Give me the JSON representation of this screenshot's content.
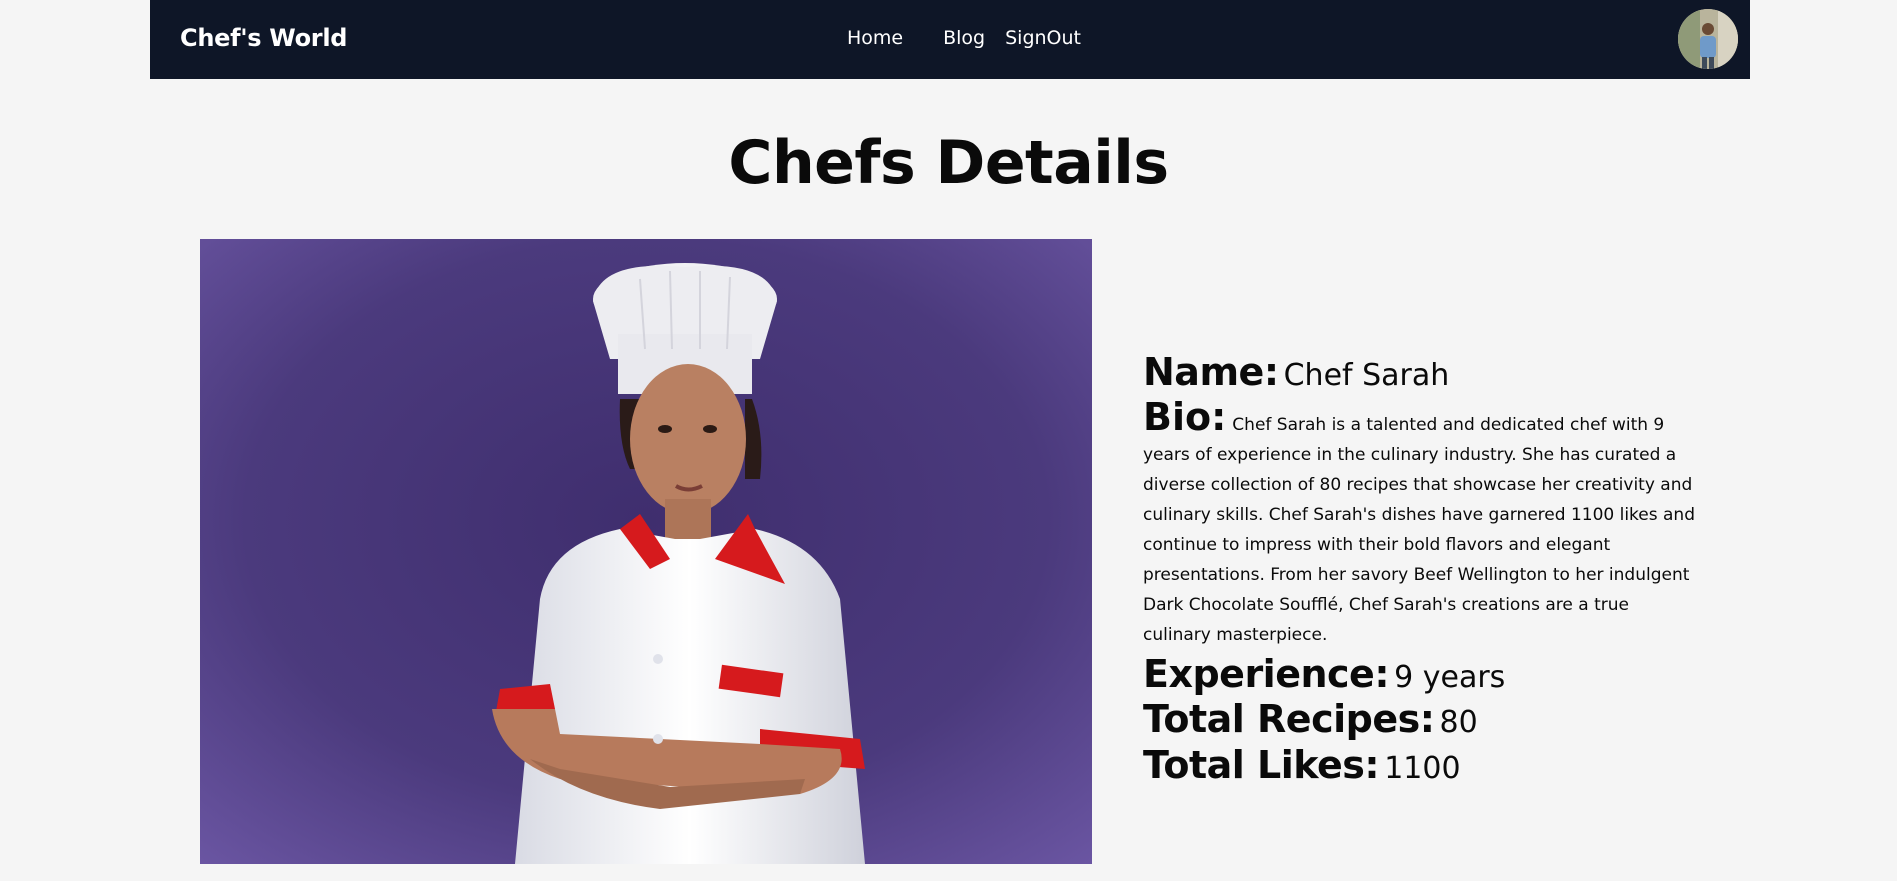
{
  "navbar": {
    "brand": "Chef's World",
    "links": [
      {
        "label": "Home"
      },
      {
        "label": "Blog"
      },
      {
        "label": "SignOut"
      }
    ],
    "avatar_icon": "user-avatar",
    "background": "#0e1627"
  },
  "page": {
    "title": "Chefs Details"
  },
  "chef": {
    "name_label": "Name:",
    "name": "Chef Sarah",
    "bio_label": "Bio:",
    "bio": "Chef Sarah is a talented and dedicated chef with 9 years of experience in the culinary industry. She has curated a diverse collection of 80 recipes that showcase her creativity and culinary skills. Chef Sarah's dishes have garnered 1100 likes and continue to impress with their bold flavors and elegant presentations. From her savory Beef Wellington to her indulgent Dark Chocolate Soufflé, Chef Sarah's creations are a true culinary masterpiece.",
    "experience_label": "Experience:",
    "experience": "9 years",
    "recipes_label": "Total Recipes:",
    "recipes": "80",
    "likes_label": "Total Likes:",
    "likes": "1100"
  }
}
